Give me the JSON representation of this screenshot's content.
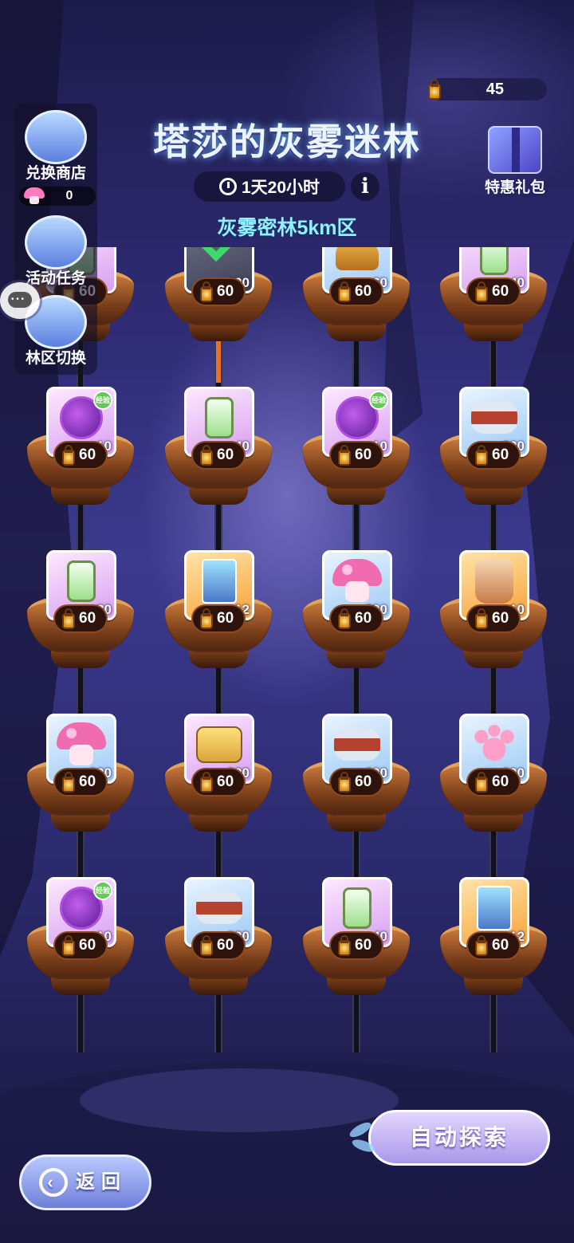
{
  "header": {
    "title": "塔莎的灰雾迷林",
    "timer": "1天20小时",
    "zone": "灰雾密林5km区",
    "info_icon": "info-icon"
  },
  "currency": {
    "value": "45",
    "icon": "lantern-icon"
  },
  "gift": {
    "label": "特惠礼包",
    "icon": "gift-box-icon"
  },
  "sidebar": {
    "shop": {
      "label": "兑换商店",
      "count": "0",
      "icon": "shop-icon"
    },
    "tasks": {
      "label": "活动任务",
      "icon": "task-document-icon"
    },
    "switch": {
      "label": "林区切换",
      "icon": "tree-icon"
    }
  },
  "grid": {
    "rows": [
      [
        {
          "item": "bottle",
          "qty": "",
          "color": "purple",
          "cost": "60"
        },
        {
          "item": "done",
          "qty": "300",
          "color": "gray",
          "cost": "60"
        },
        {
          "item": "shell",
          "qty": "60",
          "color": "blue",
          "cost": "60"
        },
        {
          "item": "bottle",
          "qty": "40",
          "color": "purple",
          "cost": "60"
        }
      ],
      [
        {
          "item": "spirit",
          "qty": "10",
          "color": "purple",
          "cost": "60",
          "exp": "经验"
        },
        {
          "item": "bottle",
          "qty": "40",
          "color": "purple",
          "cost": "60"
        },
        {
          "item": "spirit",
          "qty": "10",
          "color": "purple",
          "cost": "60",
          "exp": "经验"
        },
        {
          "item": "scarf",
          "qty": "600",
          "color": "blue",
          "cost": "60"
        }
      ],
      [
        {
          "item": "bottle",
          "qty": "30",
          "color": "purple",
          "cost": "60"
        },
        {
          "item": "card",
          "qty": "12",
          "color": "orange",
          "cost": "60"
        },
        {
          "item": "mushroom",
          "qty": "600",
          "color": "blue",
          "cost": "60"
        },
        {
          "item": "bag",
          "qty": "10",
          "color": "orange",
          "cost": "60"
        }
      ],
      [
        {
          "item": "mushroom",
          "qty": "600",
          "color": "blue",
          "cost": "60"
        },
        {
          "item": "bread",
          "qty": "300",
          "color": "purple",
          "cost": "60"
        },
        {
          "item": "scarf",
          "qty": "600",
          "color": "blue",
          "cost": "60"
        },
        {
          "item": "paw",
          "qty": "600",
          "color": "blue",
          "cost": "60"
        }
      ],
      [
        {
          "item": "spirit",
          "qty": "10",
          "color": "purple",
          "cost": "60",
          "exp": "经验"
        },
        {
          "item": "scarf",
          "qty": "600",
          "color": "blue",
          "cost": "60"
        },
        {
          "item": "bottle",
          "qty": "40",
          "color": "purple",
          "cost": "60"
        },
        {
          "item": "card",
          "qty": "12",
          "color": "orange",
          "cost": "60"
        }
      ]
    ]
  },
  "buttons": {
    "auto_explore": "自动探索",
    "back": "返回"
  }
}
